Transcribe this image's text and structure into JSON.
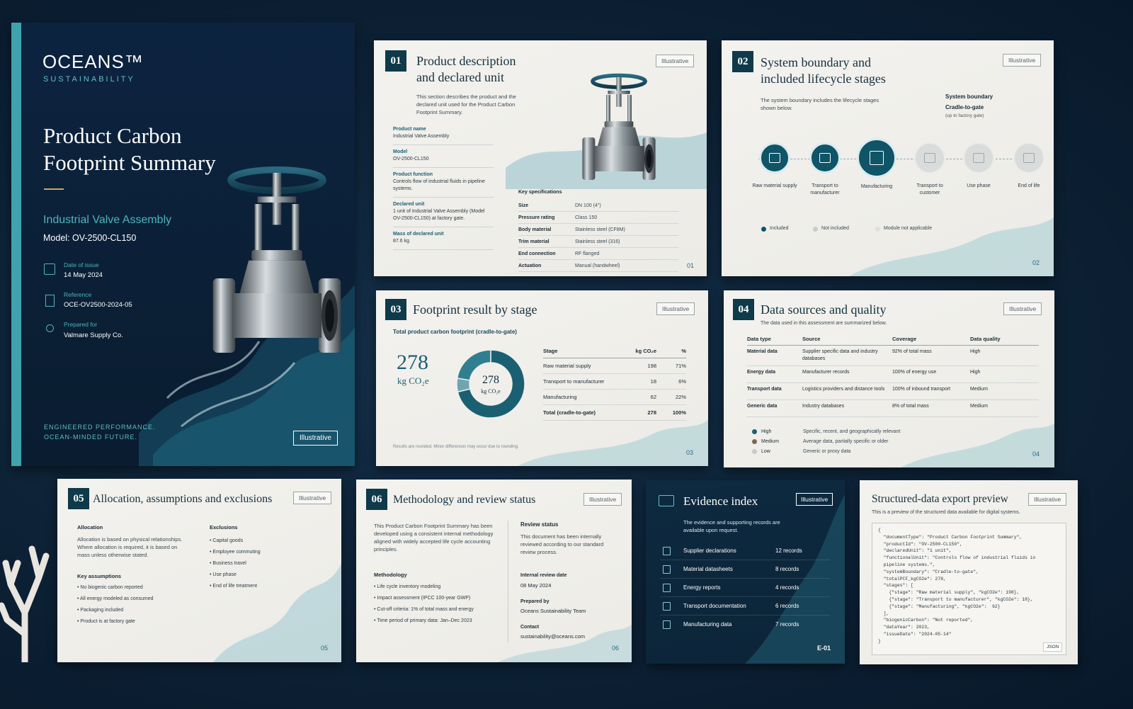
{
  "cover": {
    "brand": "OCEANS™",
    "brand_sub": "SUSTAINABILITY",
    "title_l1": "Product Carbon",
    "title_l2": "Footprint Summary",
    "product": "Industrial Valve Assembly",
    "model": "Model: OV-2500-CL150",
    "date_label": "Date of issue",
    "date": "14 May 2024",
    "ref_label": "Reference",
    "ref": "OCE-OV2500-2024-05",
    "prep_label": "Prepared for",
    "prep": "Valmare Supply Co.",
    "tag1": "ENGINEERED PERFORMANCE.",
    "tag2": "OCEAN-MINDED FUTURE.",
    "badge": "Illustrative"
  },
  "c1": {
    "num": "01",
    "title1": "Product description",
    "title2": "and declared unit",
    "badge": "Illustrative",
    "intro": "This section describes the product and the declared unit used for the Product Carbon Footprint Summary.",
    "fields": [
      {
        "k": "Product name",
        "v": "Industrial Valve Assembly"
      },
      {
        "k": "Model",
        "v": "OV-2500-CL150"
      },
      {
        "k": "Product function",
        "v": "Controls flow of industrial fluids in pipeline systems."
      },
      {
        "k": "Declared unit",
        "v": "1 unit of Industrial Valve Assembly (Model OV-2500-CL150) at factory gate."
      },
      {
        "k": "Mass of declared unit",
        "v": "87.6 kg"
      }
    ],
    "spec_title": "Key specifications",
    "specs": [
      {
        "k": "Size",
        "v": "DN 100 (4\")"
      },
      {
        "k": "Pressure rating",
        "v": "Class 150"
      },
      {
        "k": "Body material",
        "v": "Stainless steel (CF8M)"
      },
      {
        "k": "Trim material",
        "v": "Stainless steel (316)"
      },
      {
        "k": "End connection",
        "v": "RF flanged"
      },
      {
        "k": "Actuation",
        "v": "Manual (handwheel)"
      }
    ],
    "page": "01"
  },
  "c2": {
    "num": "02",
    "title1": "System boundary and",
    "title2": "included lifecycle stages",
    "badge": "Illustrative",
    "intro": "The system boundary includes the lifecycle stages shown below.",
    "sb_title": "System boundary",
    "sb_value": "Cradle-to-gate",
    "sb_note": "(up to factory gate)",
    "stages": [
      {
        "label": "Raw material supply",
        "icon": "document-icon",
        "included": true
      },
      {
        "label": "Transport to manufacturer",
        "icon": "truck-icon",
        "included": true
      },
      {
        "label": "Manufacturing",
        "icon": "factory-icon",
        "included": true
      },
      {
        "label": "Transport to customer",
        "icon": "truck-icon",
        "included": false
      },
      {
        "label": "Use phase",
        "icon": "cycle-icon",
        "included": false
      },
      {
        "label": "End of life",
        "icon": "recycle-icon",
        "included": false
      }
    ],
    "legend": [
      "Included",
      "Not included",
      "Module not applicable"
    ],
    "page": "02"
  },
  "c3": {
    "num": "03",
    "title": "Footprint result by stage",
    "badge": "Illustrative",
    "subtitle": "Total product carbon footprint (cradle-to-gate)",
    "total": "278",
    "unit": "kg CO₂e",
    "donut_total": "278",
    "donut_unit": "kg CO₂e",
    "headers": [
      "Stage",
      "kg CO₂e",
      "%"
    ],
    "rows": [
      {
        "stage": "Raw material supply",
        "kg": "198",
        "pct": "71%"
      },
      {
        "stage": "Transport to manufacturer",
        "kg": "18",
        "pct": "6%"
      },
      {
        "stage": "Manufacturing",
        "kg": "62",
        "pct": "22%"
      }
    ],
    "total_row": {
      "stage": "Total (cradle-to-gate)",
      "kg": "278",
      "pct": "100%"
    },
    "note": "Results are rounded. Minor differences may occur due to rounding.",
    "page": "03"
  },
  "chart_data": {
    "type": "pie",
    "categories": [
      "Raw material supply",
      "Transport to manufacturer",
      "Manufacturing"
    ],
    "values": [
      198,
      18,
      62
    ],
    "colors": [
      "#1b5f72",
      "#6fa5b3",
      "#2f7f90"
    ],
    "title": "Total product carbon footprint (cradle-to-gate)",
    "center_text": "278 kg CO₂e"
  },
  "c4": {
    "num": "04",
    "title": "Data sources and quality",
    "badge": "Illustrative",
    "intro": "The data used in this assessment are summarized below.",
    "headers": [
      "Data type",
      "Source",
      "Coverage",
      "Data quality"
    ],
    "rows": [
      {
        "type": "Material data",
        "source": "Supplier specific data and industry databases",
        "coverage": "92% of total mass",
        "quality": "High"
      },
      {
        "type": "Energy data",
        "source": "Manufacturer records",
        "coverage": "100% of energy use",
        "quality": "High"
      },
      {
        "type": "Transport data",
        "source": "Logistics providers and distance tools",
        "coverage": "100% of inbound transport",
        "quality": "Medium"
      },
      {
        "type": "Generic data",
        "source": "Industry databases",
        "coverage": "8% of total mass",
        "quality": "Medium"
      }
    ],
    "legend": [
      {
        "k": "High",
        "v": "Specific, recent, and geographically relevant",
        "color": "#1b5f72"
      },
      {
        "k": "Medium",
        "v": "Average data, partially specific or older",
        "color": "#7a6b4a"
      },
      {
        "k": "Low",
        "v": "Generic or proxy data",
        "color": "#c8cac8"
      }
    ],
    "page": "04"
  },
  "c5": {
    "num": "05",
    "title": "Allocation, assumptions and exclusions",
    "badge": "Illustrative",
    "alloc_title": "Allocation",
    "alloc_text": "Allocation is based on physical relationships. Where allocation is required, it is based on mass unless otherwise stated.",
    "assump_title": "Key assumptions",
    "assumptions": [
      "No biogenic carbon reported",
      "All energy modeled as consumed",
      "Packaging included",
      "Product is at factory gate"
    ],
    "excl_title": "Exclusions",
    "exclusions": [
      "Capital goods",
      "Employee commuting",
      "Business travel",
      "Use phase",
      "End of life treatment"
    ],
    "page": "05"
  },
  "c6": {
    "num": "06",
    "title": "Methodology and review status",
    "badge": "Illustrative",
    "intro": "This Product Carbon Footprint Summary has been developed using a consistent internal methodology aligned with widely accepted life cycle accounting principles.",
    "method_title": "Methodology",
    "methods": [
      "Life cycle inventory modeling",
      "Impact assessment (IPCC 100-year GWP)",
      "Cut-off criteria: 1% of total mass and energy",
      "Time period of primary data: Jan–Dec 2023"
    ],
    "review_title": "Review status",
    "review_text": "This document has been internally reviewed according to our standard review process.",
    "date_label": "Internal review date",
    "date": "08 May 2024",
    "prep_label": "Prepared by",
    "prep": "Oceans Sustainability Team",
    "contact_label": "Contact",
    "contact": "sustainability@oceans.com",
    "page": "06"
  },
  "c7": {
    "title": "Evidence index",
    "badge": "Illustrative",
    "intro": "The evidence and supporting records are available upon request.",
    "items": [
      {
        "label": "Supplier declarations",
        "count": "12 records",
        "icon": "document-icon"
      },
      {
        "label": "Material datasheets",
        "count": "8 records",
        "icon": "datasheet-icon"
      },
      {
        "label": "Energy reports",
        "count": "4 records",
        "icon": "energy-icon"
      },
      {
        "label": "Transport documentation",
        "count": "6 records",
        "icon": "truck-icon"
      },
      {
        "label": "Manufacturing data",
        "count": "7 records",
        "icon": "factory-icon"
      }
    ],
    "page": "E-01"
  },
  "c8": {
    "title": "Structured-data export preview",
    "badge": "Illustrative",
    "intro": "This is a preview of the structured data available for digital systems.",
    "json_lines": [
      "{",
      "  \"documentType\": \"Product Carbon Footprint Summary\",",
      "  \"productId\": \"OV-2500-CL150\",",
      "  \"declaredUnit\": \"1 unit\",",
      "  \"functionalUnit\": \"Controls flow of industrial fluids in",
      "  pipeline systems.\",",
      "  \"systemBoundary\": \"Cradle-to-gate\",",
      "  \"totalPCF_kgCO2e\": 278,",
      "  \"stages\": [",
      "    {\"stage\": \"Raw material supply\", \"kgCO2e\": 198},",
      "    {\"stage\": \"Transport to manufacturer\", \"kgCO2e\": 18},",
      "    {\"stage\": \"Manufacturing\", \"kgCO2e\":  62}",
      "  ],",
      "  \"biogenicCarbon\": \"Not reported\",",
      "  \"dataYear\": 2023,",
      "  \"issueDate\": \"2024-05-14\"",
      "}"
    ],
    "format": "JSON"
  }
}
